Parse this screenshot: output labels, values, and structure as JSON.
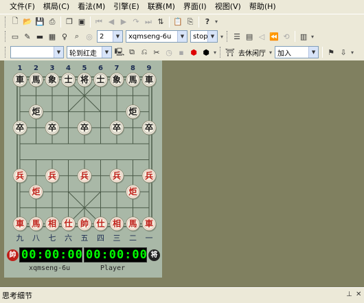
{
  "menu": [
    "文件(F)",
    "棋局(C)",
    "看法(M)",
    "引擎(E)",
    "联赛(M)",
    "界面(I)",
    "视图(V)",
    "帮助(H)"
  ],
  "toolbar2": {
    "depth_value": "2",
    "engine_value": "xqmseng-6u",
    "mode_value": "stop"
  },
  "toolbar3": {
    "turn_value": "轮到红走",
    "lobby_label": "去休闲厅",
    "join_value": "加入"
  },
  "board": {
    "file_numbers_top": [
      "1",
      "2",
      "3",
      "4",
      "5",
      "6",
      "7",
      "8",
      "9"
    ],
    "file_numbers_bottom": [
      "九",
      "八",
      "七",
      "六",
      "五",
      "四",
      "三",
      "二",
      "一"
    ],
    "black_back_rank": [
      "車",
      "馬",
      "象",
      "士",
      "将",
      "士",
      "象",
      "馬",
      "車"
    ],
    "black_cannon": "炬",
    "black_soldier": "卒",
    "red_back_rank": [
      "車",
      "馬",
      "相",
      "仕",
      "帥",
      "仕",
      "相",
      "馬",
      "車"
    ],
    "red_cannon": "炬",
    "red_soldier": "兵",
    "colors": {
      "red": "#c0201a",
      "black": "#1a1a1a",
      "piece_face": "#f4f0e2",
      "line": "#4a5a48"
    }
  },
  "clocks": {
    "red": {
      "badge": "帥",
      "time": "00:00:00",
      "name": "xqmseng-6u"
    },
    "black": {
      "badge": "将",
      "time": "00:00:00",
      "name": "Player"
    }
  },
  "status_panel": {
    "title": "思考细节"
  }
}
